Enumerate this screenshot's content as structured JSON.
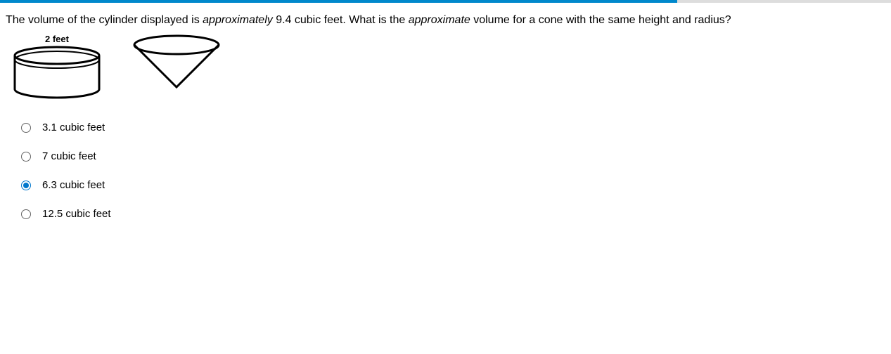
{
  "progress_percent": 76,
  "question": {
    "prefix": "The volume of the cylinder displayed is ",
    "italic1": "approximately",
    "mid": " 9.4 cubic feet. What is the ",
    "italic2": "approximate",
    "suffix": " volume for a cone with the same height and radius?"
  },
  "figure_label": "2 feet",
  "options": [
    {
      "label": "3.1 cubic feet",
      "selected": false
    },
    {
      "label": "7 cubic feet",
      "selected": false
    },
    {
      "label": "6.3 cubic feet",
      "selected": true
    },
    {
      "label": "12.5 cubic feet",
      "selected": false
    }
  ]
}
